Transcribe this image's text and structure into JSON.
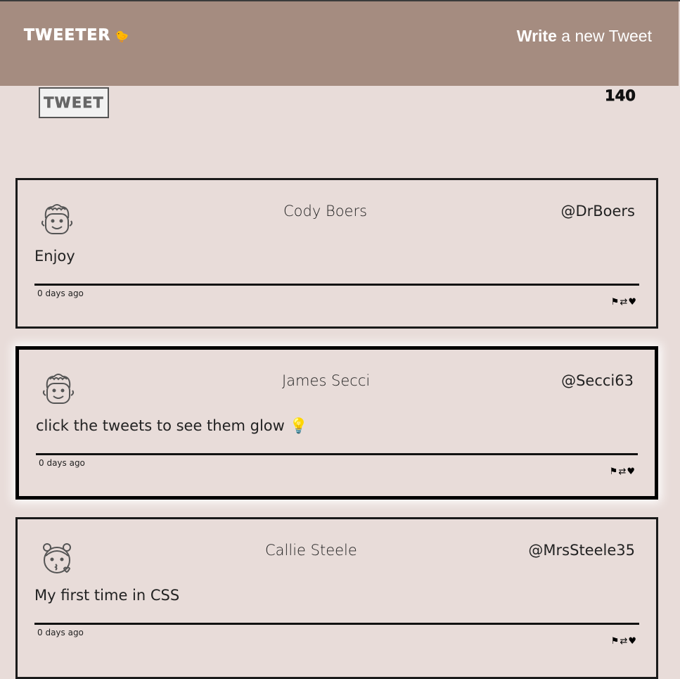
{
  "nav": {
    "brand": "TWEETER",
    "brand_emoji": "🐤",
    "write_bold": "Write",
    "write_rest": " a new Tweet"
  },
  "composer": {
    "tweet_button_label": "TWEET",
    "char_counter": "140"
  },
  "tweets": [
    {
      "name": "Cody Boers",
      "handle": "@DrBoers",
      "content": "Enjoy",
      "timestamp": "0 days ago",
      "avatar_icon": "curly-hair-face-icon",
      "glow": false
    },
    {
      "name": "James Secci",
      "handle": "@Secci63",
      "content": "click the tweets to see them glow 💡",
      "timestamp": "0 days ago",
      "avatar_icon": "curly-hair-face-icon",
      "glow": true
    },
    {
      "name": "Callie Steele",
      "handle": "@MrsSteele35",
      "content": "My first time in CSS",
      "timestamp": "0 days ago",
      "avatar_icon": "kissing-face-with-buns-icon",
      "glow": false
    }
  ],
  "action_icons": {
    "flag": "⚑",
    "retweet": "⇄",
    "heart": "♥"
  },
  "colors": {
    "navbar": "#a58c80",
    "background": "#e8dcd9",
    "border": "#111111"
  }
}
